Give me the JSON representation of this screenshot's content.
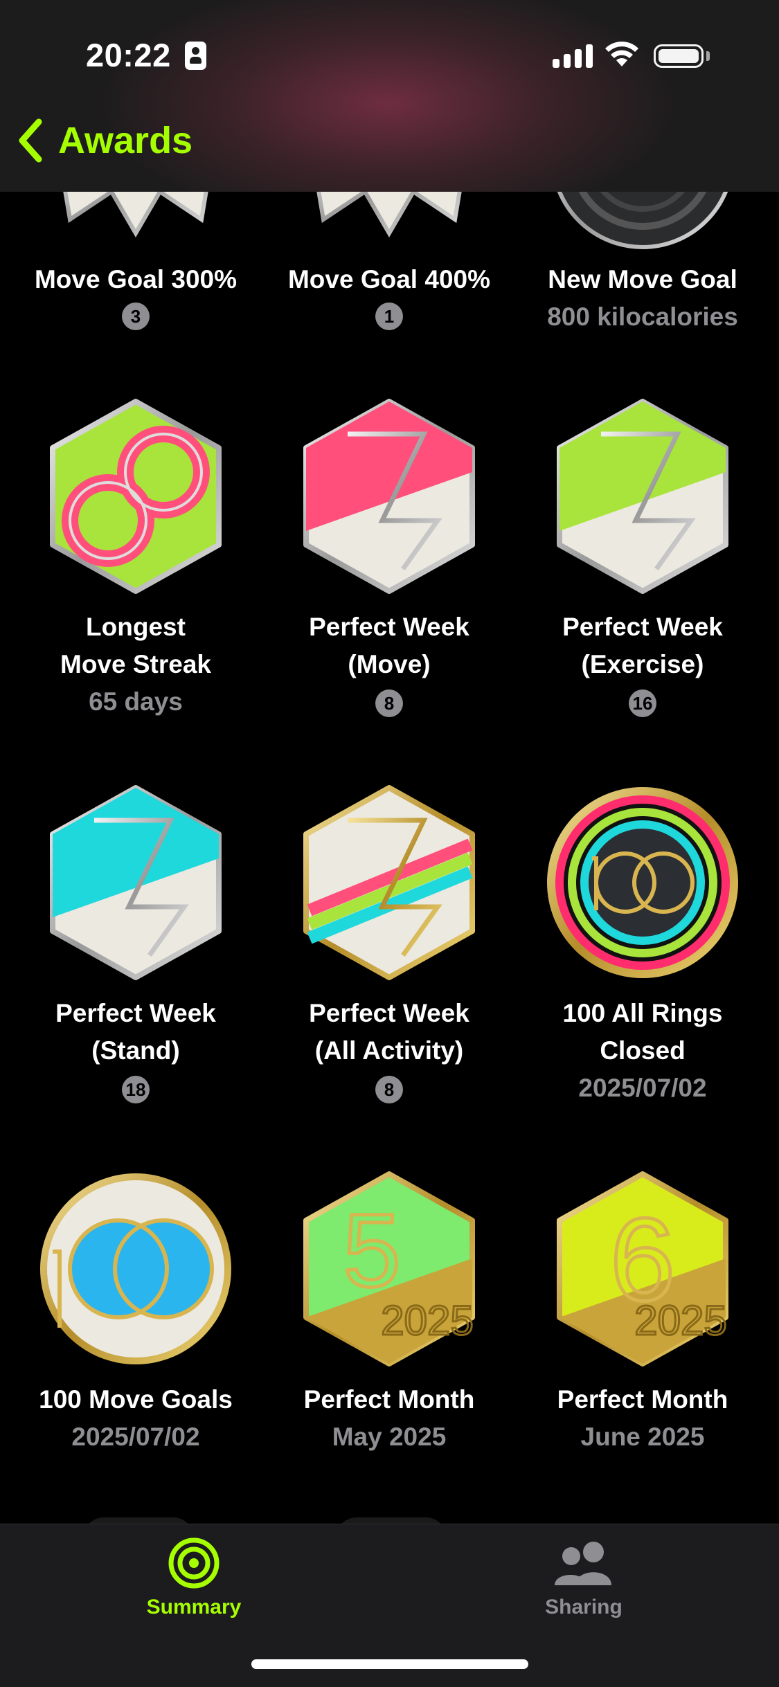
{
  "status_bar": {
    "time": "20:22"
  },
  "nav": {
    "back_label": "Awards",
    "accent": "#a6ff00"
  },
  "awards": [
    {
      "name": "Move Goal 300%",
      "count": "3",
      "icon": "move-goal-300-badge"
    },
    {
      "name": "Move Goal 400%",
      "count": "1",
      "icon": "move-goal-400-badge"
    },
    {
      "name": "New Move Goal",
      "sub": "800 kilocalories",
      "icon": "new-move-goal-badge"
    },
    {
      "name": "Longest",
      "name2": "Move Streak",
      "sub": "65 days",
      "icon": "longest-move-streak-badge"
    },
    {
      "name": "Perfect Week",
      "name2": "(Move)",
      "count": "8",
      "icon": "perfect-week-move-badge"
    },
    {
      "name": "Perfect Week",
      "name2": "(Exercise)",
      "count": "16",
      "icon": "perfect-week-exercise-badge"
    },
    {
      "name": "Perfect Week",
      "name2": "(Stand)",
      "count": "18",
      "icon": "perfect-week-stand-badge"
    },
    {
      "name": "Perfect Week",
      "name2": "(All Activity)",
      "count": "8",
      "icon": "perfect-week-all-activity-badge"
    },
    {
      "name": "100 All Rings",
      "name2": "Closed",
      "sub": "2025/07/02",
      "icon": "100-all-rings-badge"
    },
    {
      "name": "100 Move Goals",
      "sub": "2025/07/02",
      "icon": "100-move-goals-badge"
    },
    {
      "name": "Perfect Month",
      "sub": "May 2025",
      "icon": "perfect-month-may-badge"
    },
    {
      "name": "Perfect Month",
      "sub": "June 2025",
      "icon": "perfect-month-june-badge"
    }
  ],
  "tabs": [
    {
      "label": "Summary",
      "icon": "activity-rings-icon",
      "color": "#a6ff00"
    },
    {
      "label": "Sharing",
      "icon": "people-icon",
      "color": "#8e8e93"
    }
  ]
}
